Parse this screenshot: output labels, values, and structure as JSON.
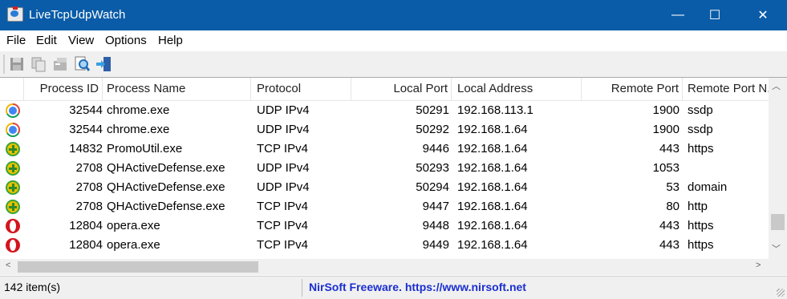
{
  "window": {
    "title": "LiveTcpUdpWatch",
    "minimize_glyph": "—",
    "maximize_glyph": "☐",
    "close_glyph": "✕"
  },
  "menu": [
    "File",
    "Edit",
    "View",
    "Options",
    "Help"
  ],
  "toolbar": {
    "buttons": [
      "save-icon",
      "copy-icon",
      "properties-icon",
      "find-icon",
      "exit-icon"
    ]
  },
  "table": {
    "columns": [
      "",
      "Process ID",
      "Process Name",
      "Protocol",
      "Local Port",
      "Local Address",
      "Remote Port",
      "Remote Port N..."
    ],
    "rows": [
      {
        "icon": "chrome-icon",
        "pid": "32544",
        "name": "chrome.exe",
        "protocol": "UDP IPv4",
        "local_port": "50291",
        "local_address": "192.168.113.1",
        "remote_port": "1900",
        "remote_port_name": "ssdp"
      },
      {
        "icon": "chrome-icon",
        "pid": "32544",
        "name": "chrome.exe",
        "protocol": "UDP IPv4",
        "local_port": "50292",
        "local_address": "192.168.1.64",
        "remote_port": "1900",
        "remote_port_name": "ssdp"
      },
      {
        "icon": "plus-shield-icon",
        "pid": "14832",
        "name": "PromoUtil.exe",
        "protocol": "TCP IPv4",
        "local_port": "9446",
        "local_address": "192.168.1.64",
        "remote_port": "443",
        "remote_port_name": "https"
      },
      {
        "icon": "plus-shield-icon",
        "pid": "2708",
        "name": "QHActiveDefense.exe",
        "protocol": "UDP IPv4",
        "local_port": "50293",
        "local_address": "192.168.1.64",
        "remote_port": "1053",
        "remote_port_name": ""
      },
      {
        "icon": "plus-shield-icon",
        "pid": "2708",
        "name": "QHActiveDefense.exe",
        "protocol": "UDP IPv4",
        "local_port": "50294",
        "local_address": "192.168.1.64",
        "remote_port": "53",
        "remote_port_name": "domain"
      },
      {
        "icon": "plus-shield-icon",
        "pid": "2708",
        "name": "QHActiveDefense.exe",
        "protocol": "TCP IPv4",
        "local_port": "9447",
        "local_address": "192.168.1.64",
        "remote_port": "80",
        "remote_port_name": "http"
      },
      {
        "icon": "opera-icon",
        "pid": "12804",
        "name": "opera.exe",
        "protocol": "TCP IPv4",
        "local_port": "9448",
        "local_address": "192.168.1.64",
        "remote_port": "443",
        "remote_port_name": "https"
      },
      {
        "icon": "opera-icon",
        "pid": "12804",
        "name": "opera.exe",
        "protocol": "TCP IPv4",
        "local_port": "9449",
        "local_address": "192.168.1.64",
        "remote_port": "443",
        "remote_port_name": "https"
      }
    ]
  },
  "scroll": {
    "up_glyph": "︿",
    "down_glyph": "﹀",
    "left_glyph": "<",
    "right_glyph": ">"
  },
  "status": {
    "count": "142 item(s)",
    "credit": "NirSoft Freeware. https://www.nirsoft.net"
  },
  "colors": {
    "titlebar": "#0a5ca8",
    "credit": "#1a2fd0"
  }
}
